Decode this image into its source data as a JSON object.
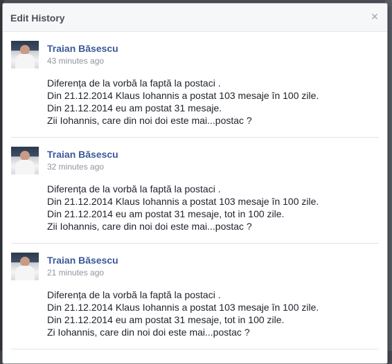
{
  "dialog": {
    "title": "Edit History",
    "close_label": "×"
  },
  "entries": [
    {
      "author": "Traian Băsescu",
      "time": "43 minutes ago",
      "lines": [
        "Diferența de la vorbă la faptă la postaci .",
        "Din 21.12.2014 Klaus Iohannis a postat 103 mesaje în 100 zile.",
        "Din 21.12.2014 eu am postat 31 mesaje.",
        "Zii Iohannis, care din noi doi este mai...postac ?"
      ]
    },
    {
      "author": "Traian Băsescu",
      "time": "32 minutes ago",
      "lines": [
        "Diferența de la vorbă la faptă la postaci .",
        "Din 21.12.2014 Klaus Iohannis a postat 103 mesaje în 100 zile.",
        "Din 21.12.2014 eu am postat 31 mesaje, tot in 100 zile.",
        "Zii Iohannis, care din noi doi este mai...postac ?"
      ]
    },
    {
      "author": "Traian Băsescu",
      "time": "21 minutes ago",
      "lines": [
        "Diferența de la vorbă la faptă la postaci .",
        "Din 21.12.2014 Klaus Iohannis a postat 103 mesaje în 100 zile.",
        "Din 21.12.2014 eu am postat 31 mesaje, tot in 100 zile.",
        "Zi Iohannis, care din noi doi este mai...postac ?"
      ]
    }
  ]
}
